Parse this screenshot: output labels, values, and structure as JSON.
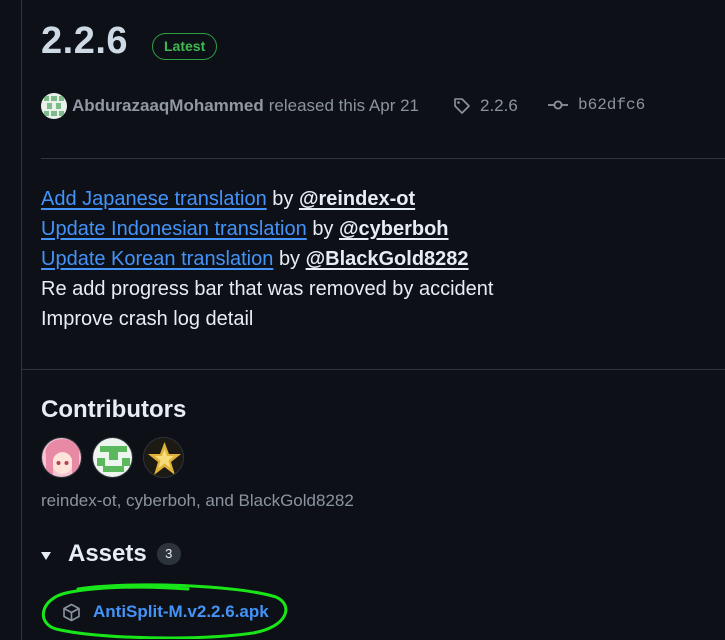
{
  "release": {
    "version": "2.2.6",
    "badge": "Latest",
    "author": "AbdurazaaqMohammed",
    "released_text": "released this Apr 21",
    "tag": "2.2.6",
    "commit": "b62dfc6"
  },
  "notes": [
    {
      "link": "Add Japanese translation",
      "by": "by",
      "mention": "@reindex-ot"
    },
    {
      "link": "Update Indonesian translation",
      "by": "by",
      "mention": "@cyberboh"
    },
    {
      "link": "Update Korean translation",
      "by": "by",
      "mention": "@BlackGold8282"
    },
    {
      "text": "Re add progress bar that was removed by accident"
    },
    {
      "text": "Improve crash log detail"
    }
  ],
  "contributors": {
    "title": "Contributors",
    "names": "reindex-ot, cyberboh, and BlackGold8282"
  },
  "assets": {
    "title": "Assets",
    "count": "3",
    "items": [
      {
        "name": "AntiSplit-M.v2.2.6.apk"
      }
    ]
  },
  "colors": {
    "background": "#0d1117",
    "link": "#4493f8",
    "latest_badge": "#3fb950",
    "annotation_circle": "#19e619"
  }
}
